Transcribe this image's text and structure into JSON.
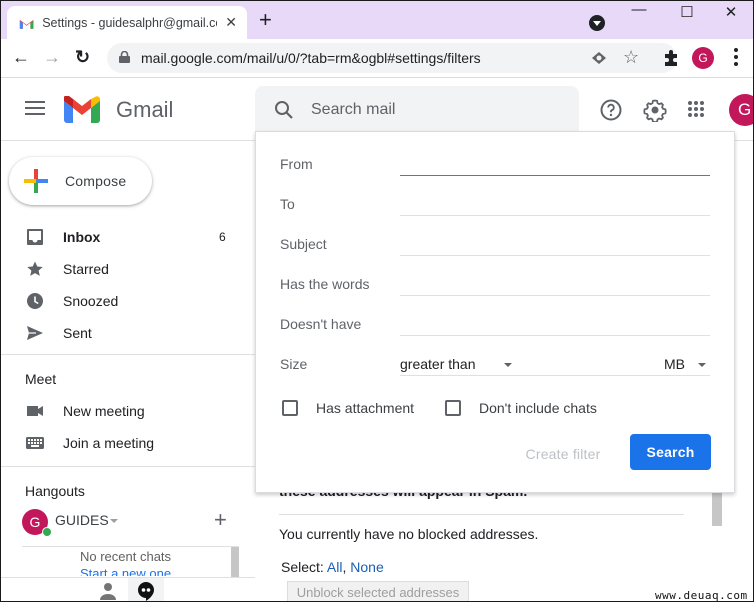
{
  "browser": {
    "tab_title": "Settings - guidesalphr@gmail.com",
    "tab_close": "✕",
    "new_tab": "+",
    "url": "mail.google.com/mail/u/0/?tab=rm&ogbl#settings/filters",
    "star": "☆",
    "profile_initial": "G",
    "window_controls": {
      "minimize": "—",
      "maximize": "☐",
      "close": "✕"
    },
    "nav": {
      "back": "←",
      "forward": "→",
      "reload": "↻"
    }
  },
  "gmail": {
    "brand": "Gmail",
    "search_placeholder": "Search mail",
    "account_initial": "G"
  },
  "sidebar": {
    "compose_label": "Compose",
    "items": [
      {
        "label": "Inbox",
        "count": "6",
        "icon": "inbox-icon",
        "bold": true
      },
      {
        "label": "Starred",
        "count": "",
        "icon": "star-icon"
      },
      {
        "label": "Snoozed",
        "count": "",
        "icon": "clock-icon"
      },
      {
        "label": "Sent",
        "count": "",
        "icon": "send-icon"
      }
    ],
    "meet": {
      "title": "Meet",
      "items": [
        {
          "label": "New meeting",
          "icon": "video-camera-icon"
        },
        {
          "label": "Join a meeting",
          "icon": "keyboard-icon"
        }
      ]
    },
    "hangouts": {
      "title": "Hangouts",
      "user_initial": "G",
      "user_name": "GUIDES",
      "add": "+",
      "no_recent": "No recent chats",
      "start_new": "Start a new one"
    }
  },
  "search_options": {
    "fields": [
      {
        "label": "From",
        "value": ""
      },
      {
        "label": "To",
        "value": ""
      },
      {
        "label": "Subject",
        "value": ""
      },
      {
        "label": "Has the words",
        "value": ""
      },
      {
        "label": "Doesn't have",
        "value": ""
      }
    ],
    "size": {
      "label": "Size",
      "operator": "greater than",
      "value": "",
      "unit": "MB"
    },
    "checkboxes": [
      {
        "label": "Has attachment",
        "checked": false
      },
      {
        "label": "Don't include chats",
        "checked": false
      }
    ],
    "create_filter_label": "Create filter",
    "search_label": "Search"
  },
  "main": {
    "spam_note": "these addresses will appear in Spam.",
    "no_blocked": "You currently have no blocked addresses.",
    "select_prefix": "Select: ",
    "select_all": "All",
    "select_sep": ", ",
    "select_none": "None",
    "unblock_label": "Unblock selected addresses"
  },
  "watermark": "www.deuaq.com",
  "colors": {
    "tabstrip": "#e8d9f8",
    "accent_blue": "#1a73e8",
    "avatar": "#c2185b",
    "online": "#34a853"
  }
}
